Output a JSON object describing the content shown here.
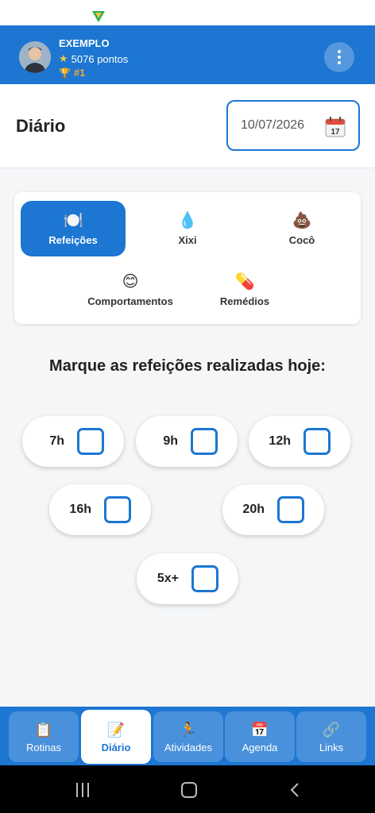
{
  "app": {
    "accent_color": "#1c76d2"
  },
  "user": {
    "name": "EXEMPLO",
    "points": "5076 pontos",
    "rank": "#1"
  },
  "header": {
    "title": "Diário",
    "date_value": "10/07/2026",
    "calendar_day": "17"
  },
  "categories": [
    {
      "label": "Refeições",
      "icon": "plate-icon",
      "emoji": "🍽️",
      "active": true
    },
    {
      "label": "Xixi",
      "icon": "droplet-icon",
      "emoji": "💧",
      "active": false
    },
    {
      "label": "Cocô",
      "icon": "poop-icon",
      "emoji": "💩",
      "active": false
    },
    {
      "label": "Comportamentos",
      "icon": "smile-icon",
      "emoji": "😊",
      "active": false
    },
    {
      "label": "Remédios",
      "icon": "pill-icon",
      "emoji": "💊",
      "active": false
    }
  ],
  "question": "Marque as refeições realizadas hoje:",
  "meals": [
    {
      "label": "7h",
      "checked": false
    },
    {
      "label": "9h",
      "checked": false
    },
    {
      "label": "12h",
      "checked": false
    },
    {
      "label": "16h",
      "checked": false
    },
    {
      "label": "20h",
      "checked": false
    },
    {
      "label": "5x+",
      "checked": false
    }
  ],
  "bottom_nav": [
    {
      "label": "Rotinas",
      "icon": "clipboard-icon",
      "emoji": "📋",
      "active": false
    },
    {
      "label": "Diário",
      "icon": "memo-icon",
      "emoji": "📝",
      "active": true
    },
    {
      "label": "Atividades",
      "icon": "runner-icon",
      "emoji": "🏃",
      "active": false
    },
    {
      "label": "Agenda",
      "icon": "calendar-icon",
      "emoji": "📅",
      "active": false
    },
    {
      "label": "Links",
      "icon": "link-icon",
      "emoji": "🔗",
      "active": false
    }
  ]
}
